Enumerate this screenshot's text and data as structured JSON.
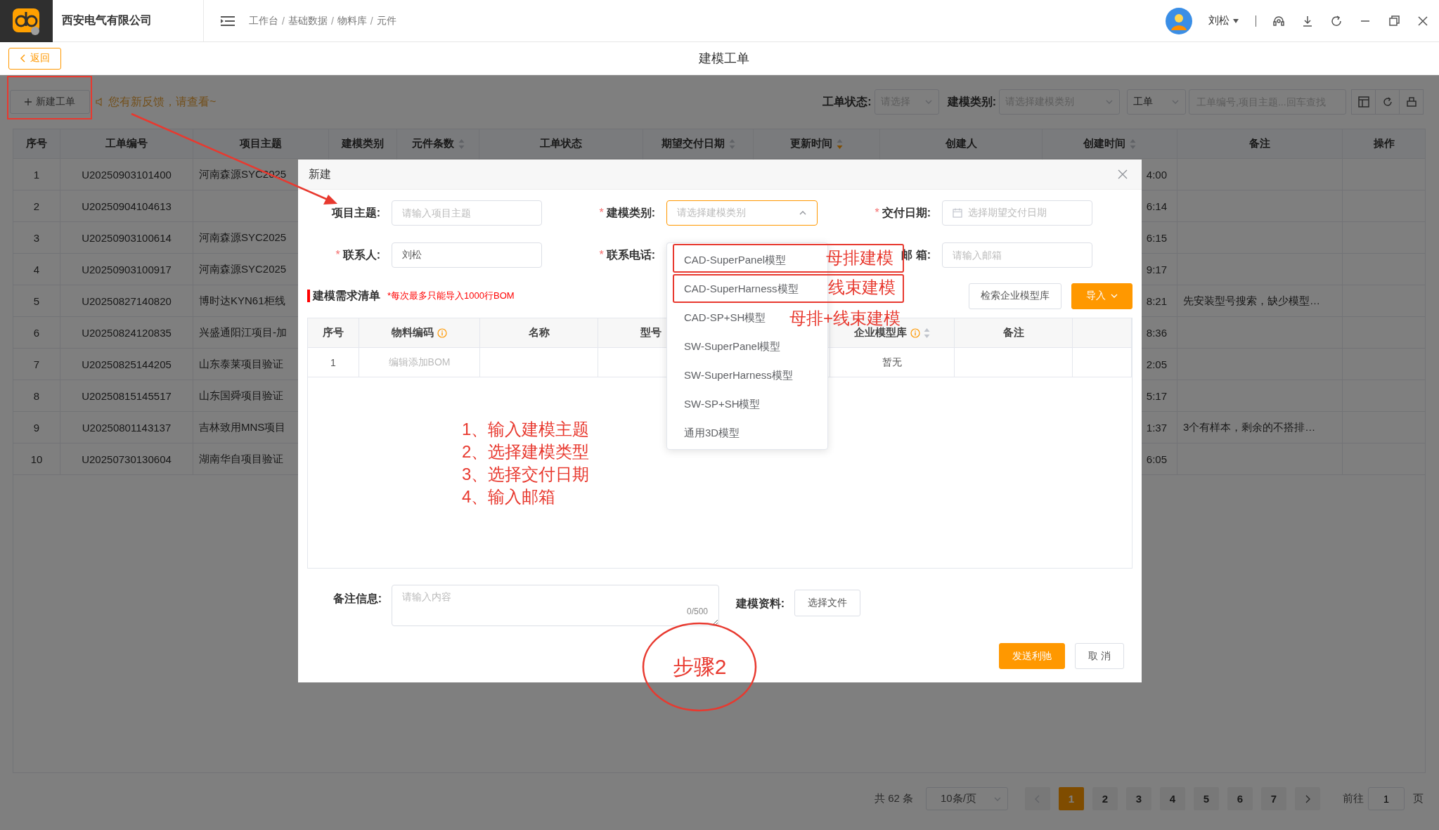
{
  "app": {
    "company": "西安电气有限公司",
    "breadcrumb": [
      "工作台",
      "基础数据",
      "物料库",
      "元件"
    ],
    "breadcrumb_separator": "/",
    "user": "刘松"
  },
  "page": {
    "back": "返回",
    "title": "建模工单"
  },
  "toolbar": {
    "new_button": "新建工单",
    "notice": "您有新反馈，请查看~",
    "filters": [
      {
        "label": "工单状态:",
        "placeholder": "请选择"
      },
      {
        "label": "建模类别:",
        "placeholder": "请选择建模类别"
      },
      {
        "value": "工单"
      }
    ],
    "search_placeholder": "工单编号,项目主题...回车查找"
  },
  "table": {
    "columns": [
      {
        "label": "序号"
      },
      {
        "label": "工单编号"
      },
      {
        "label": "项目主题"
      },
      {
        "label": "建模类别"
      },
      {
        "label": "元件条数",
        "sortable": true,
        "descending": false
      },
      {
        "label": "工单状态"
      },
      {
        "label": "期望交付日期",
        "sortable": true,
        "descending": false
      },
      {
        "label": "更新时间",
        "sortable": true,
        "descending": true
      },
      {
        "label": "创建人"
      },
      {
        "label": "创建时间",
        "sortable": true,
        "descending": false
      },
      {
        "label": "备注"
      },
      {
        "label": "操作"
      }
    ],
    "rows": [
      {
        "no": "1",
        "order_no": "U20250903101400",
        "subject": "河南森源SYC2025",
        "created": "4:00"
      },
      {
        "no": "2",
        "order_no": "U20250904104613",
        "created": "6:14"
      },
      {
        "no": "3",
        "order_no": "U20250903100614",
        "subject": "河南森源SYC2025",
        "created": "6:15"
      },
      {
        "no": "4",
        "order_no": "U20250903100917",
        "subject": "河南森源SYC2025",
        "created": "9:17"
      },
      {
        "no": "5",
        "order_no": "U20250827140820",
        "subject": "博时达KYN61柜线",
        "created": "8:21",
        "remark": "先安装型号搜索，缺少模型…"
      },
      {
        "no": "6",
        "order_no": "U20250824120835",
        "subject": "兴盛通阳江项目-加",
        "created": "8:36"
      },
      {
        "no": "7",
        "order_no": "U20250825144205",
        "subject": "山东泰莱项目验证",
        "created": "2:05"
      },
      {
        "no": "8",
        "order_no": "U20250815145517",
        "subject": "山东国舜项目验证",
        "created": "5:17"
      },
      {
        "no": "9",
        "order_no": "U20250801143137",
        "subject": "吉林致用MNS项目",
        "created": "1:37",
        "remark": "3个有样本，剩余的不搭排…"
      },
      {
        "no": "10",
        "order_no": "U20250730130604",
        "subject": "湖南华自项目验证",
        "created": "6:05"
      }
    ]
  },
  "pagination": {
    "total": "共 62 条",
    "page_size": "10条/页",
    "pages": [
      {
        "label": "1",
        "selected": true
      },
      {
        "label": "2",
        "selected": false
      },
      {
        "label": "3",
        "selected": false
      },
      {
        "label": "4",
        "selected": false
      },
      {
        "label": "5",
        "selected": false
      },
      {
        "label": "6",
        "selected": false
      },
      {
        "label": "7",
        "selected": false
      }
    ],
    "goto_label": "前往",
    "goto_value": "1",
    "goto_suffix": "页"
  },
  "dialog": {
    "title": "新建",
    "required_mark": "*",
    "fields": [
      {
        "label": "项目主题:",
        "required": false,
        "kind": "text",
        "placeholder": "请输入项目主题"
      },
      {
        "label": "建模类别:",
        "required": true,
        "kind": "select",
        "placeholder": "请选择建模类别",
        "open": true
      },
      {
        "label": "交付日期:",
        "required": true,
        "kind": "date",
        "placeholder": "选择期望交付日期"
      },
      {
        "label": "联系人:",
        "required": true,
        "kind": "text",
        "value": "刘松"
      },
      {
        "label": "联系电话:",
        "required": true,
        "kind": "text"
      },
      {
        "label": "邮 箱:",
        "required": false,
        "kind": "text",
        "placeholder": "请输入邮箱"
      }
    ],
    "options": [
      {
        "label": "CAD-SuperPanel模型"
      },
      {
        "label": "CAD-SuperHarness模型"
      },
      {
        "label": "CAD-SP+SH模型"
      },
      {
        "label": "SW-SuperPanel模型"
      },
      {
        "label": "SW-SuperHarness模型"
      },
      {
        "label": "SW-SP+SH模型"
      },
      {
        "label": "通用3D模型"
      }
    ],
    "section": {
      "title": "建模需求清单",
      "note": "*每次最多只能导入1000行BOM",
      "buttons": [
        {
          "label": "检索企业模型库",
          "kind": "default"
        },
        {
          "label": "导入",
          "kind": "primary",
          "caret": true
        }
      ]
    },
    "bom_columns": [
      {
        "label": "序号"
      },
      {
        "label": "物料编码",
        "info": true
      },
      {
        "label": "名称"
      },
      {
        "label": "型号"
      },
      {
        "label": "企业模型库",
        "info": true,
        "sortable": true,
        "descending": false
      },
      {
        "label": "备注"
      }
    ],
    "bom_rows": [
      {
        "no": "1",
        "code_placeholder": "编辑添加BOM",
        "library": "暂无"
      }
    ],
    "remark": {
      "label": "备注信息:",
      "placeholder": "请输入内容",
      "counter": "0/500"
    },
    "attachment": {
      "label": "建模资料:",
      "button": "选择文件"
    },
    "footer_buttons": [
      {
        "label": "发送利驰",
        "kind": "primary"
      },
      {
        "label": "取 消",
        "kind": "default"
      }
    ]
  },
  "annotations": {
    "option_notes": [
      {
        "text": "母排建模",
        "boxed": true
      },
      {
        "text": "线束建模",
        "boxed": true
      },
      {
        "text": "母排+线束建模",
        "boxed": false
      }
    ],
    "steps": [
      "1、输入建模主题",
      "2、选择建模类型",
      "3、选择交付日期",
      "4、输入邮箱"
    ],
    "step_label": "步骤2"
  }
}
